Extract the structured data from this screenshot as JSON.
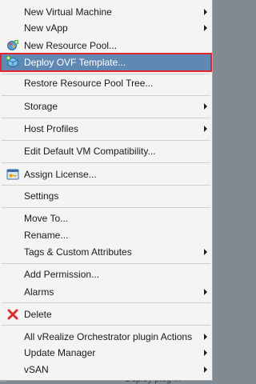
{
  "menu": {
    "new_vm": "New Virtual Machine",
    "new_vapp": "New vApp",
    "new_resource_pool": "New Resource Pool...",
    "deploy_ovf": "Deploy OVF Template...",
    "restore_pool_tree": "Restore Resource Pool Tree...",
    "storage": "Storage",
    "host_profiles": "Host Profiles",
    "edit_vm_compat": "Edit Default VM Compatibility...",
    "assign_license": "Assign License...",
    "settings": "Settings",
    "move_to": "Move To...",
    "rename": "Rename...",
    "tags": "Tags & Custom Attributes",
    "add_permission": "Add Permission...",
    "alarms": "Alarms",
    "delete": "Delete",
    "vro_actions": "All vRealize Orchestrator plugin Actions",
    "update_manager": "Update Manager",
    "vsan": "vSAN"
  },
  "background": {
    "partial_text": "Deploy plug-in"
  },
  "colors": {
    "menu_bg": "#f4f4f4",
    "selected_bg": "#5f89b3",
    "highlight_border": "#e0262f"
  }
}
